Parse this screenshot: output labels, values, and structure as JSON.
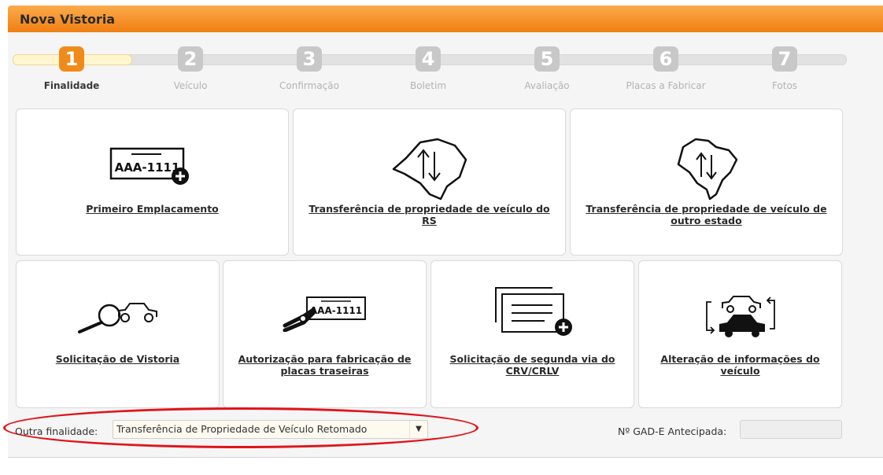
{
  "header": {
    "title": "Nova Vistoria"
  },
  "steps": [
    {
      "number": "1",
      "label": "Finalidade"
    },
    {
      "number": "2",
      "label": "Veículo"
    },
    {
      "number": "3",
      "label": "Confirmação"
    },
    {
      "number": "4",
      "label": "Boletim"
    },
    {
      "number": "5",
      "label": "Avaliação"
    },
    {
      "number": "6",
      "label": "Placas a Fabricar"
    },
    {
      "number": "7",
      "label": "Fotos"
    }
  ],
  "cards": [
    {
      "label": "Primeiro Emplacamento",
      "plate": "AAA-1111",
      "icon": "license-plate-add-icon"
    },
    {
      "label": "Transferência de propriedade de veículo do RS",
      "icon": "rs-map-transfer-icon"
    },
    {
      "label": "Transferência de propriedade de veículo de outro estado",
      "icon": "brazil-map-transfer-icon"
    },
    {
      "label": "Solicitação de Vistoria",
      "icon": "magnifier-car-icon"
    },
    {
      "label": "Autorização para fabricação de placas traseiras",
      "plate": "AAA-1111",
      "icon": "plate-pliers-icon"
    },
    {
      "label": "Solicitação de segunda via do CRV/CRLV",
      "icon": "document-copy-add-icon"
    },
    {
      "label": "Alteração de informações do veículo",
      "icon": "car-swap-icon"
    }
  ],
  "bottom": {
    "other_label": "Outra finalidade:",
    "other_value": "Transferência de Propriedade de Veículo Retomado",
    "gad_label": "Nº GAD-E Antecipada:",
    "gad_value": ""
  },
  "colors": {
    "header": "#f39a2e",
    "active_step": "#f08b1a",
    "highlight": "#e0141a"
  }
}
